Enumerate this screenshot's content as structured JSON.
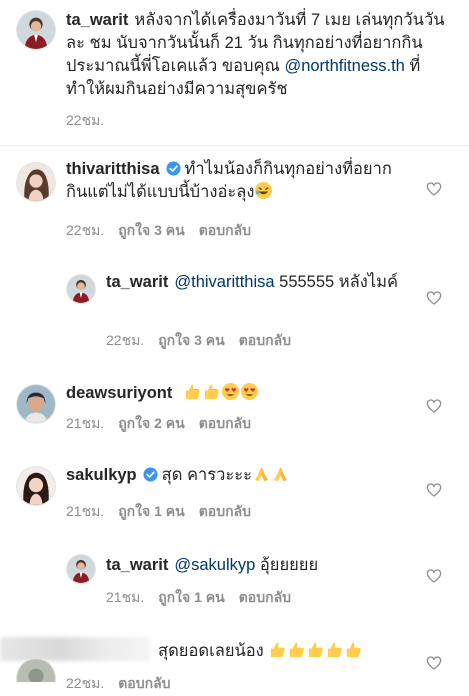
{
  "post": {
    "username": "ta_warit",
    "text_1": "หลังจากได้เครื่องมาวันที่ 7 เมย เล่นทุกวันวัน ละ ชม นับจากวันนั้นก็ 21 วัน กินทุกอย่างที่อยากกิน ประมาณนี้พี่โอเคแล้ว ขอบคุณ ",
    "mention": "@northfitness.th",
    "text_2": " ที่ทำให้ผมกินอย่างมีความสุขครัช",
    "time": "22ชม."
  },
  "comments": [
    {
      "username": "thivaritthisa",
      "verified": true,
      "text": "ทำไมน้องก็กินทุกอย่างที่อยากกินแต่ไม่ได้แบบนี้บ้างอ่ะลุง",
      "time": "22ชม.",
      "likes": "ถูกใจ 3 คน",
      "reply": "ตอบกลับ"
    },
    {
      "username": "ta_warit",
      "mention": "@thivaritthisa",
      "text": " 555555 หลังไมค์",
      "time": "22ชม.",
      "likes": "ถูกใจ 3 คน",
      "reply": "ตอบกลับ"
    },
    {
      "username": "deawsuriyont",
      "text": "",
      "time": "21ชม.",
      "likes": "ถูกใจ 2 คน",
      "reply": "ตอบกลับ"
    },
    {
      "username": "sakulkyp",
      "verified": true,
      "text": "สุด คารวะะะ",
      "time": "21ชม.",
      "likes": "ถูกใจ 1 คน",
      "reply": "ตอบกลับ"
    },
    {
      "username": "ta_warit",
      "mention": "@sakulkyp",
      "text": " อุ้ยยยยย",
      "time": "21ชม.",
      "likes": "ถูกใจ 1 คน",
      "reply": "ตอบกลับ"
    },
    {
      "text": "สุดยอดเลยน้อง",
      "time": "22ชม.",
      "reply": "ตอบกลับ"
    }
  ],
  "colors": {
    "text": "#262626",
    "meta": "#8e8e8e",
    "mention": "#00376b",
    "verified": "#3897f0"
  },
  "icons": {
    "like": "heart-outline-icon",
    "verified": "verified-badge-icon",
    "thumbs": "thumbs-up-emoji",
    "hearteyes": "heart-eyes-emoji",
    "pray": "folded-hands-emoji",
    "rofl": "rolling-laughing-emoji"
  }
}
